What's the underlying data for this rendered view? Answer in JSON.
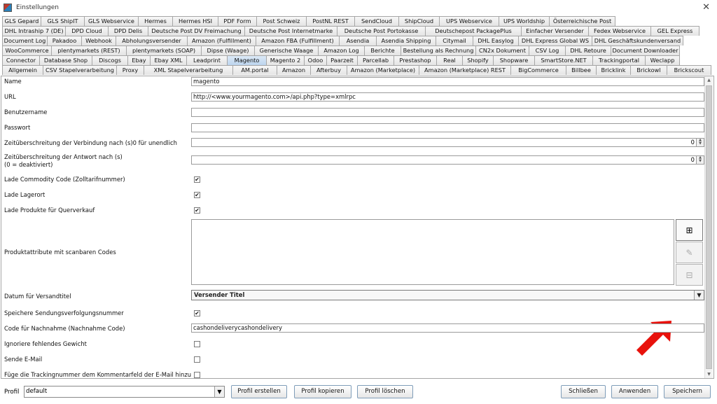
{
  "window": {
    "title": "Einstellungen",
    "close_symbol": "✕"
  },
  "tabs": {
    "rows": [
      [
        "GLS Gepard",
        "GLS ShipIT",
        "GLS Webservice",
        "Hermes",
        "Hermes HSI",
        "PDF Form",
        "Post Schweiz",
        "PostNL REST",
        "SendCloud",
        "ShipCloud",
        "UPS Webservice",
        "UPS Worldship",
        "Österreichische Post"
      ],
      [
        "DHL Intraship 7 (DE)",
        "DPD Cloud",
        "DPD Delis",
        "Deutsche Post DV Freimachung",
        "Deutsche Post Internetmarke",
        "Deutsche Post Portokasse",
        "Deutschepost PackagePlus",
        "Einfacher Versender",
        "Fedex Webservice",
        "GEL Express"
      ],
      [
        "Document Log",
        "Pakadoo",
        "Webhook",
        "Abholungsversender",
        "Amazon (Fulfillment)",
        "Amazon FBA (Fulfillment)",
        "Asendia",
        "Asendia Shipping",
        "Citymail",
        "DHL Easylog",
        "DHL Express Global WS",
        "DHL Geschäftskundenversand"
      ],
      [
        "WooCommerce",
        "plentymarkets (REST)",
        "plentymarkets (SOAP)",
        "Dipse (Waage)",
        "Generische Waage",
        "Amazon Log",
        "Berichte",
        "Bestellung als Rechnung",
        "CN2x Dokument",
        "CSV Log",
        "DHL Retoure",
        "Document Downloader"
      ],
      [
        "Connector",
        "Database Shop",
        "Discogs",
        "Ebay",
        "Ebay XML",
        "Leadprint",
        "Magento",
        "Magento 2",
        "Odoo",
        "Paarzeit",
        "Parcellab",
        "Prestashop",
        "Real",
        "Shopify",
        "Shopware",
        "SmartStore.NET",
        "Trackingportal",
        "Weclapp"
      ],
      [
        "Allgemein",
        "CSV Stapelverarbeitung",
        "Proxy",
        "XML Stapelverarbeitung",
        "AM.portal",
        "Amazon",
        "Afterbuy",
        "Amazon (Marketplace)",
        "Amazon (Marketplace) REST",
        "BigCommerce",
        "Billbee",
        "Bricklink",
        "Brickowl",
        "Brickscout"
      ]
    ],
    "active": "Magento"
  },
  "form": {
    "name_label": "Name",
    "name_value": "magento",
    "url_label": "URL",
    "url_value": "http://<www.yourmagento.com>/api.php?type=xmlrpc",
    "user_label": "Benutzername",
    "user_value": "",
    "pass_label": "Passwort",
    "pass_value": "",
    "conn_timeout_label": "Zeitüberschreitung der Verbindung nach (s)0 für unendlich",
    "conn_timeout_value": "0",
    "resp_timeout_label_1": "Zeitüberschreitung der Antwort nach (s)",
    "resp_timeout_label_2": "(0 = deaktiviert)",
    "resp_timeout_value": "0",
    "commodity_label": "Lade Commodity Code (Zolltarifnummer)",
    "commodity_checked": true,
    "lagerort_label": "Lade Lagerort",
    "lagerort_checked": true,
    "crosssell_label": "Lade Produkte für Querverkauf",
    "crosssell_checked": true,
    "attributes_label": "Produktattribute mit scanbaren Codes",
    "datum_label": "Datum für Versandtitel",
    "datum_value": "Versender Titel",
    "save_tracking_label": "Speichere Sendungsverfolgungsnummer",
    "save_tracking_checked": true,
    "cod_label": "Code für Nachnahme (Nachnahme Code)",
    "cod_value": "cashondeliverycashondelivery",
    "ignore_weight_label": "Ignoriere fehlendes Gewicht",
    "ignore_weight_checked": false,
    "send_email_label": "Sende E-Mail",
    "send_email_checked": false,
    "add_tracking_label": "Füge die Trackingnummer dem Kommentarfeld der E-Mail hinzu",
    "add_tracking_checked": false
  },
  "icons": {
    "add": "⊞",
    "edit": "✎",
    "remove": "⊟",
    "check": "✔",
    "dropdown": "▼",
    "up": "▲",
    "down": "▼"
  },
  "colors": {
    "arrow": "#e8120c",
    "active_tab": "#c6dbf1"
  },
  "footer": {
    "profile_label": "Profil",
    "profile_value": "default",
    "create": "Profil erstellen",
    "copy": "Profil kopieren",
    "delete": "Profil löschen",
    "close": "Schließen",
    "apply": "Anwenden",
    "save": "Speichern"
  }
}
